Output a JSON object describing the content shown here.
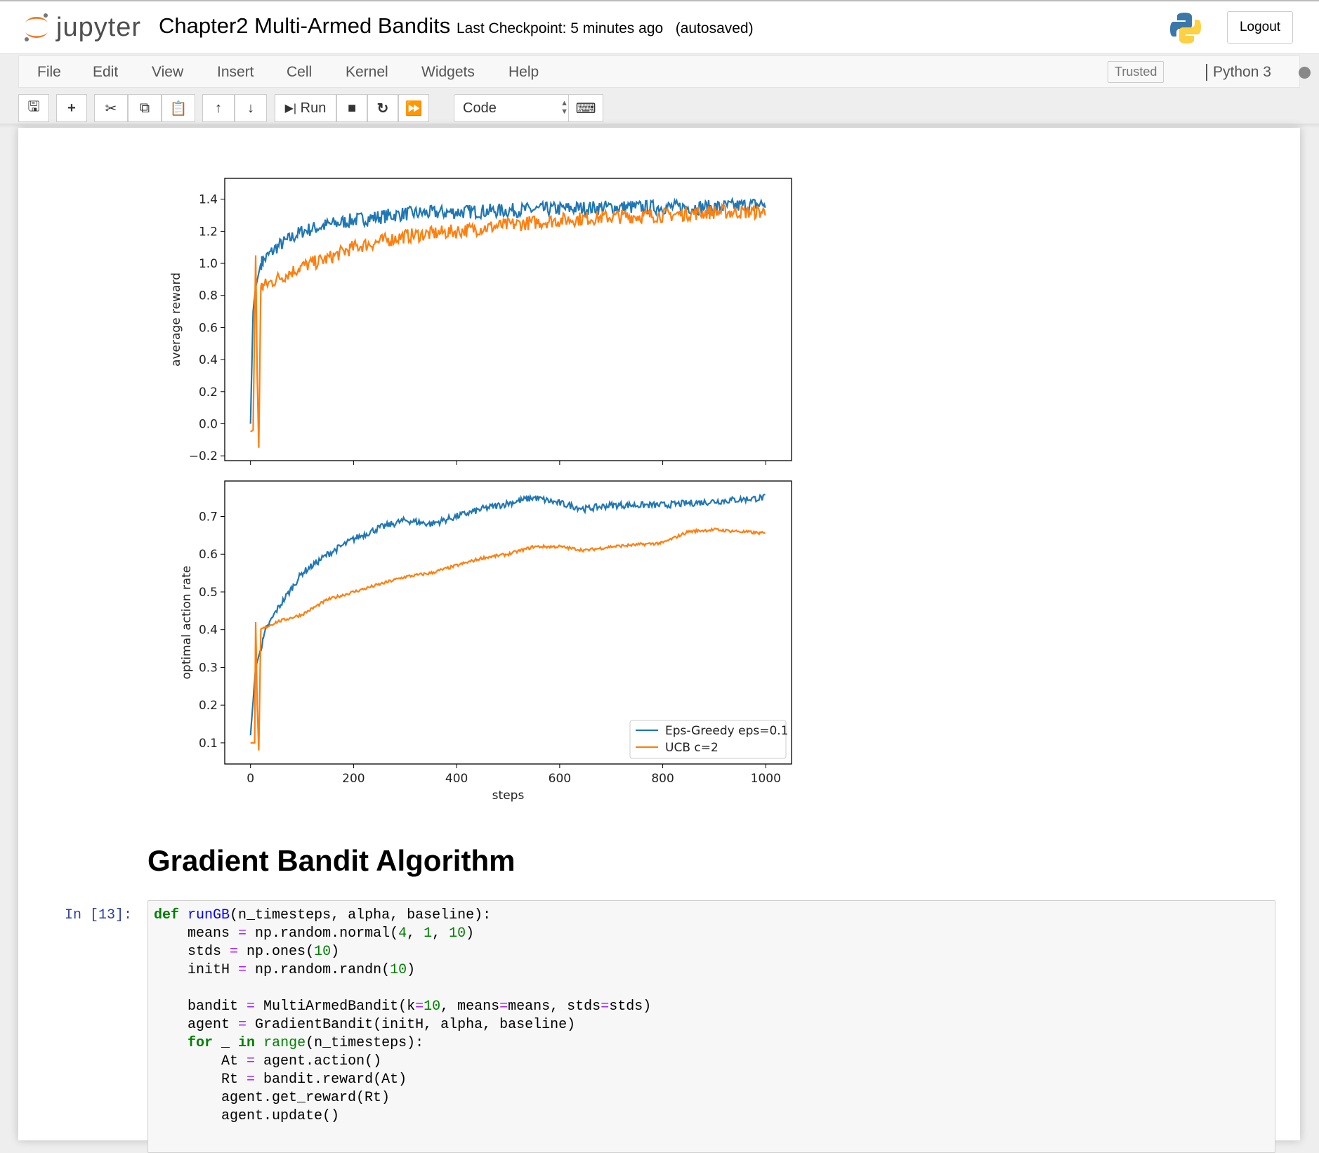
{
  "header": {
    "logo_text": "jupyter",
    "notebook_title": "Chapter2 Multi-Armed Bandits",
    "checkpoint": "Last Checkpoint: 5 minutes ago",
    "autosaved": "(autosaved)",
    "logout_label": "Logout"
  },
  "menu": {
    "items": [
      "File",
      "Edit",
      "View",
      "Insert",
      "Cell",
      "Kernel",
      "Widgets",
      "Help"
    ],
    "trusted": "Trusted",
    "kernel_name": "Python 3"
  },
  "toolbar": {
    "run_label": "Run",
    "cell_type": "Code",
    "icons": [
      "save-icon",
      "plus-icon",
      "cut-icon",
      "copy-icon",
      "paste-icon",
      "arrow-up-icon",
      "arrow-down-icon",
      "run-icon",
      "stop-icon",
      "restart-icon",
      "fast-forward-icon",
      "keyboard-icon"
    ]
  },
  "colors": {
    "eps": "#1f77b4",
    "ucb": "#ff7f0e",
    "prompt": "#303f9f"
  },
  "chart_data": [
    {
      "type": "line",
      "ylabel": "average reward",
      "xlim": [
        -50,
        1050
      ],
      "ylim": [
        -0.23,
        1.53
      ],
      "yticks": [
        "−0.2",
        "0.0",
        "0.2",
        "0.4",
        "0.6",
        "0.8",
        "1.0",
        "1.2",
        "1.4"
      ],
      "ytick_values": [
        -0.2,
        0,
        0.2,
        0.4,
        0.6,
        0.8,
        1.0,
        1.2,
        1.4
      ],
      "xtick_values": [
        0,
        200,
        400,
        600,
        800,
        1000
      ],
      "series": [
        {
          "name": "Eps-Greedy eps=0.1",
          "x": [
            0,
            5,
            10,
            20,
            50,
            100,
            150,
            200,
            300,
            400,
            500,
            600,
            700,
            800,
            900,
            1000
          ],
          "y": [
            0.0,
            0.7,
            0.85,
            1.0,
            1.1,
            1.2,
            1.24,
            1.27,
            1.31,
            1.32,
            1.33,
            1.34,
            1.35,
            1.35,
            1.35,
            1.37
          ]
        },
        {
          "name": "UCB c=2",
          "x": [
            0,
            5,
            10,
            13,
            16,
            20,
            50,
            100,
            150,
            200,
            300,
            400,
            500,
            600,
            700,
            800,
            900,
            1000
          ],
          "y": [
            -0.05,
            -0.04,
            1.05,
            0.3,
            -0.15,
            0.85,
            0.9,
            0.98,
            1.03,
            1.1,
            1.17,
            1.2,
            1.24,
            1.27,
            1.29,
            1.3,
            1.32,
            1.32
          ]
        }
      ]
    },
    {
      "type": "line",
      "xlabel": "steps",
      "ylabel": "optimal action rate",
      "xlim": [
        -50,
        1050
      ],
      "ylim": [
        0.044,
        0.794
      ],
      "yticks": [
        "0.1",
        "0.2",
        "0.3",
        "0.4",
        "0.5",
        "0.6",
        "0.7"
      ],
      "ytick_values": [
        0.1,
        0.2,
        0.3,
        0.4,
        0.5,
        0.6,
        0.7
      ],
      "xticks": [
        "0",
        "200",
        "400",
        "600",
        "800",
        "1000"
      ],
      "xtick_values": [
        0,
        200,
        400,
        600,
        800,
        1000
      ],
      "legend": "lower-right",
      "series": [
        {
          "name": "Eps-Greedy eps=0.1",
          "x": [
            0,
            10,
            30,
            50,
            100,
            150,
            200,
            250,
            300,
            350,
            400,
            450,
            550,
            650,
            700,
            800,
            900,
            1000
          ],
          "y": [
            0.12,
            0.3,
            0.4,
            0.45,
            0.55,
            0.6,
            0.64,
            0.67,
            0.69,
            0.68,
            0.7,
            0.72,
            0.75,
            0.72,
            0.73,
            0.73,
            0.74,
            0.75
          ]
        },
        {
          "name": "UCB c=2",
          "x": [
            0,
            8,
            10,
            13,
            16,
            20,
            50,
            100,
            150,
            200,
            250,
            300,
            350,
            400,
            450,
            500,
            550,
            600,
            650,
            700,
            800,
            850,
            900,
            1000
          ],
          "y": [
            0.1,
            0.1,
            0.42,
            0.2,
            0.08,
            0.4,
            0.42,
            0.44,
            0.48,
            0.5,
            0.52,
            0.54,
            0.55,
            0.57,
            0.59,
            0.6,
            0.62,
            0.62,
            0.61,
            0.62,
            0.63,
            0.66,
            0.665,
            0.655
          ]
        }
      ]
    }
  ],
  "markdown": {
    "heading": "Gradient Bandit Algorithm"
  },
  "code_cell": {
    "prompt": "In [13]:",
    "lines": [
      [
        [
          "def",
          "kw"
        ],
        [
          " ",
          ""
        ],
        [
          "runGB",
          "def"
        ],
        [
          "(n_timesteps, alpha, baseline):",
          ""
        ]
      ],
      [
        [
          "    means ",
          ""
        ],
        [
          "=",
          "op"
        ],
        [
          " np.random.normal(",
          ""
        ],
        [
          "4",
          "num"
        ],
        [
          ", ",
          ""
        ],
        [
          "1",
          "num"
        ],
        [
          ", ",
          ""
        ],
        [
          "10",
          "num"
        ],
        [
          ")",
          ""
        ]
      ],
      [
        [
          "    stds ",
          ""
        ],
        [
          "=",
          "op"
        ],
        [
          " np.ones(",
          ""
        ],
        [
          "10",
          "num"
        ],
        [
          ")",
          ""
        ]
      ],
      [
        [
          "    initH ",
          ""
        ],
        [
          "=",
          "op"
        ],
        [
          " np.random.randn(",
          ""
        ],
        [
          "10",
          "num"
        ],
        [
          ")",
          ""
        ]
      ],
      [],
      [
        [
          "    bandit ",
          ""
        ],
        [
          "=",
          "op"
        ],
        [
          " MultiArmedBandit(k",
          ""
        ],
        [
          "=",
          "op"
        ],
        [
          "10",
          "num"
        ],
        [
          ", means",
          ""
        ],
        [
          "=",
          "op"
        ],
        [
          "means, stds",
          ""
        ],
        [
          "=",
          "op"
        ],
        [
          "stds)",
          ""
        ]
      ],
      [
        [
          "    agent ",
          ""
        ],
        [
          "=",
          "op"
        ],
        [
          " GradientBandit(initH, alpha, baseline)",
          ""
        ]
      ],
      [
        [
          "    ",
          ""
        ],
        [
          "for",
          "kw"
        ],
        [
          " _ ",
          ""
        ],
        [
          "in",
          "kw"
        ],
        [
          " ",
          ""
        ],
        [
          "range",
          "bi"
        ],
        [
          "(n_timesteps):",
          ""
        ]
      ],
      [
        [
          "        At ",
          ""
        ],
        [
          "=",
          "op"
        ],
        [
          " agent.action()",
          ""
        ]
      ],
      [
        [
          "        Rt ",
          ""
        ],
        [
          "=",
          "op"
        ],
        [
          " bandit.reward(At)",
          ""
        ]
      ],
      [
        [
          "        agent.get_reward(Rt)",
          ""
        ]
      ],
      [
        [
          "        agent.update()",
          ""
        ]
      ]
    ]
  }
}
